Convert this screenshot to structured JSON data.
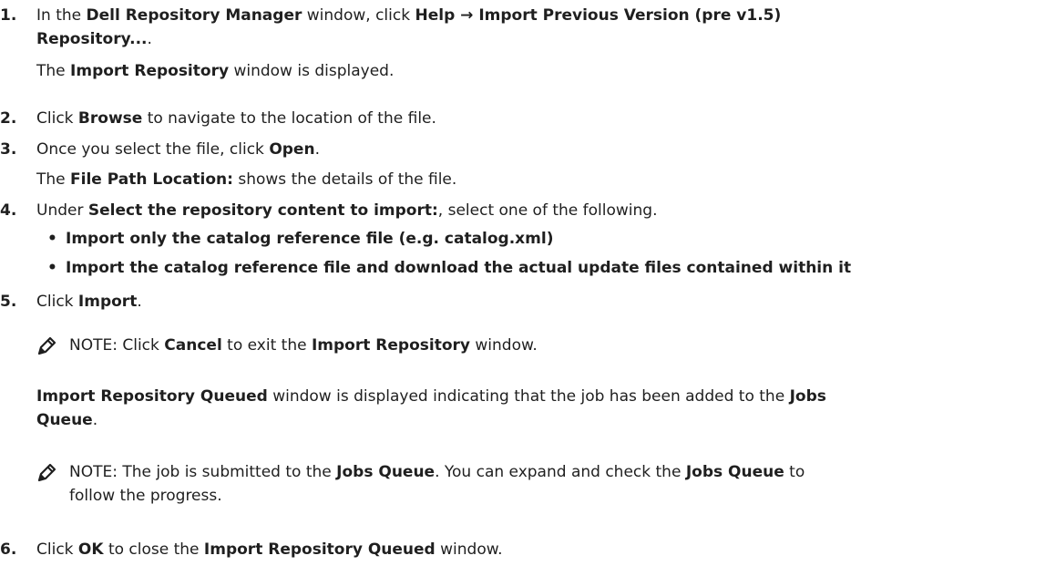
{
  "steps": [
    {
      "num": "1.",
      "line1_a": "In the ",
      "line1_b": "Dell Repository Manager",
      "line1_c": " window, click ",
      "line1_d": "Help → Import Previous Version (pre v1.5)",
      "line2_bold": "Repository...",
      "line2_end": ".",
      "sub_a": "The ",
      "sub_b": "Import Repository",
      "sub_c": " window is displayed."
    },
    {
      "num": "2.",
      "a": "Click ",
      "b": "Browse",
      "c": " to navigate to the location of the file."
    },
    {
      "num": "3.",
      "a": "Once you select the file, click ",
      "b": "Open",
      "c": ".",
      "sub_a": "The ",
      "sub_b": "File Path Location:",
      "sub_c": " shows the details of the file."
    },
    {
      "num": "4.",
      "a": "Under ",
      "b": "Select the repository content to import:",
      "c": ", select one of the following.",
      "options": [
        "Import only the catalog reference file (e.g. catalog.xml)",
        "Import the catalog reference file and download the actual update files contained within it"
      ]
    },
    {
      "num": "5.",
      "a": "Click ",
      "b": "Import",
      "c": ".",
      "note1": {
        "label": "NOTE:",
        "a": " Click ",
        "b": "Cancel",
        "c": " to exit the ",
        "d": "Import Repository",
        "e": " window."
      },
      "para": {
        "a": "Import Repository Queued",
        "b": " window is displayed indicating that the job has been added to the ",
        "c": "Jobs",
        "d": "Queue",
        "e": "."
      },
      "note2": {
        "label": "NOTE:",
        "a": " The job is submitted to the ",
        "b": "Jobs Queue",
        "c": ". You can expand and check the ",
        "d": "Jobs Queue",
        "e": " to",
        "f": "follow the progress."
      }
    },
    {
      "num": "6.",
      "a": "Click ",
      "b": "OK",
      "c": " to close the ",
      "d": "Import Repository Queued",
      "e": " window."
    }
  ],
  "icons": {
    "note": "pencil-note-icon"
  }
}
